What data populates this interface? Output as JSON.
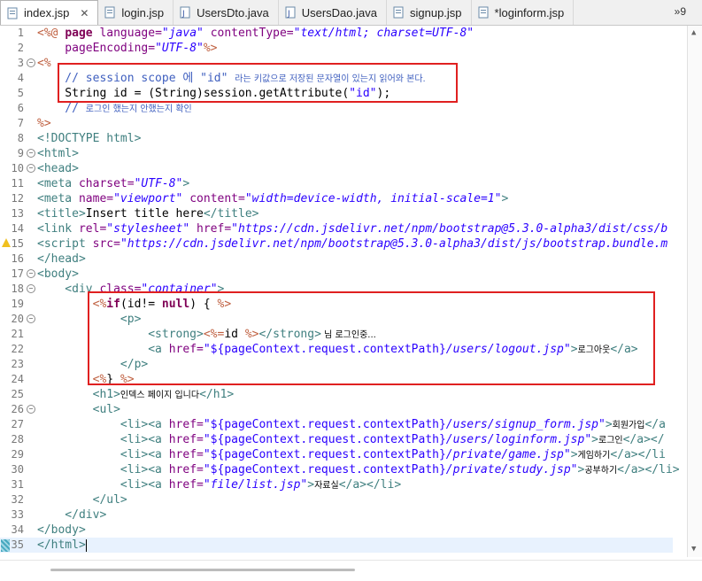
{
  "tabs": [
    {
      "label": "index.jsp",
      "icon": "jsp-file-icon",
      "active": true
    },
    {
      "label": "login.jsp",
      "icon": "jsp-file-icon"
    },
    {
      "label": "UsersDto.java",
      "icon": "java-file-icon"
    },
    {
      "label": "UsersDao.java",
      "icon": "java-file-icon"
    },
    {
      "label": "signup.jsp",
      "icon": "jsp-file-icon"
    },
    {
      "label": "*loginform.jsp",
      "icon": "jsp-file-icon"
    }
  ],
  "overflow_label": "»9",
  "lines": [
    {
      "n": "1"
    },
    {
      "n": "2"
    },
    {
      "n": "3"
    },
    {
      "n": "4"
    },
    {
      "n": "5"
    },
    {
      "n": "6"
    },
    {
      "n": "7"
    },
    {
      "n": "8"
    },
    {
      "n": "9"
    },
    {
      "n": "10"
    },
    {
      "n": "11"
    },
    {
      "n": "12"
    },
    {
      "n": "13"
    },
    {
      "n": "14"
    },
    {
      "n": "15"
    },
    {
      "n": "16"
    },
    {
      "n": "17"
    },
    {
      "n": "18"
    },
    {
      "n": "19"
    },
    {
      "n": "20"
    },
    {
      "n": "21"
    },
    {
      "n": "22"
    },
    {
      "n": "23"
    },
    {
      "n": "24"
    },
    {
      "n": "25"
    },
    {
      "n": "26"
    },
    {
      "n": "27"
    },
    {
      "n": "28"
    },
    {
      "n": "29"
    },
    {
      "n": "30"
    },
    {
      "n": "31"
    },
    {
      "n": "32"
    },
    {
      "n": "33"
    },
    {
      "n": "34"
    },
    {
      "n": "35"
    }
  ],
  "code": {
    "l1a": "<%@ ",
    "l1b": "page ",
    "l1c": "language=",
    "l1d": "\"java\"",
    "l1e": " contentType=",
    "l1f": "\"text/html; charset=UTF-8\"",
    "l2a": "    pageEncoding=",
    "l2b": "\"UTF-8\"",
    "l2c": "%>",
    "l3": "<%",
    "l4a": "    // session scope 에 \"id\" ",
    "l4b": "라는 키값으로 저장된 문자열이 있는지 읽어와 본다.",
    "l5a": "    String id = (String)session.getAttribute(",
    "l5b": "\"id\"",
    "l5c": ");",
    "l6a": "    // ",
    "l6b": "로그인 했는지 안했는지 확인",
    "l7": "%>",
    "l8": "<!DOCTYPE html>",
    "l9": "<html>",
    "l10": "<head>",
    "l11a": "<meta ",
    "l11b": "charset=",
    "l11c": "\"UTF-8\"",
    "l11d": ">",
    "l12a": "<meta ",
    "l12b": "name=",
    "l12c": "\"viewport\"",
    "l12d": " content=",
    "l12e": "\"width=device-width, initial-scale=1\"",
    "l12f": ">",
    "l13a": "<title>",
    "l13b": "Insert title here",
    "l13c": "</title>",
    "l14a": "<link ",
    "l14b": "rel=",
    "l14c": "\"stylesheet\"",
    "l14d": " href=",
    "l14e": "\"https://cdn.jsdelivr.net/npm/bootstrap@5.3.0-alpha3/dist/css/b",
    "l15a": "<script ",
    "l15b": "src=",
    "l15c": "\"https://cdn.jsdelivr.net/npm/bootstrap@5.3.0-alpha3/dist/js/bootstrap.bundle.m",
    "l16": "</head>",
    "l17": "<body>",
    "l18a": "    <div ",
    "l18b": "class=",
    "l18c": "\"container\"",
    "l18d": ">",
    "l19a": "        <%",
    "l19b": "if",
    "l19c": "(id!= ",
    "l19d": "null",
    "l19e": ") { ",
    "l19f": "%>",
    "l20": "            <p>",
    "l21a": "                <strong>",
    "l21b": "<%=",
    "l21c": "id ",
    "l21d": "%>",
    "l21e": "</strong>",
    "l21f": " 님 로그인중...",
    "l22a": "                <a ",
    "l22b": "href=",
    "l22c": "\"${pageContext.request.contextPath}",
    "l22d": "/users/logout.jsp\"",
    "l22e": ">",
    "l22f": "로그아웃",
    "l22g": "</a>",
    "l23": "            </p>",
    "l24a": "        <%",
    "l24b": "} ",
    "l24c": "%>",
    "l25a": "        <h1>",
    "l25b": "인덱스 페이지 입니다",
    "l25c": "</h1>",
    "l26": "        <ul>",
    "l27a": "            <li><a ",
    "l27b": "href=",
    "l27c": "\"${pageContext.request.contextPath}",
    "l27d": "/users/signup_form.jsp\"",
    "l27e": ">",
    "l27f": "회원가입",
    "l27g": "</a",
    "l28a": "            <li><a ",
    "l28b": "href=",
    "l28c": "\"${pageContext.request.contextPath}",
    "l28d": "/users/loginform.jsp\"",
    "l28e": ">",
    "l28f": "로그인",
    "l28g": "</a></",
    "l29a": "            <li><a ",
    "l29b": "href=",
    "l29c": "\"${pageContext.request.contextPath}",
    "l29d": "/private/game.jsp\"",
    "l29e": ">",
    "l29f": "게임하기",
    "l29g": "</a></li",
    "l30a": "            <li><a ",
    "l30b": "href=",
    "l30c": "\"${pageContext.request.contextPath}",
    "l30d": "/private/study.jsp\"",
    "l30e": ">",
    "l30f": "공부하기",
    "l30g": "</a></li>",
    "l31a": "            <li><a ",
    "l31b": "href=",
    "l31c": "\"file/list.jsp\"",
    "l31d": ">",
    "l31e": "자료실",
    "l31f": "</a></li>",
    "l32": "        </ul>",
    "l33": "    </div>",
    "l34": "</body>",
    "l35": "</html>"
  }
}
